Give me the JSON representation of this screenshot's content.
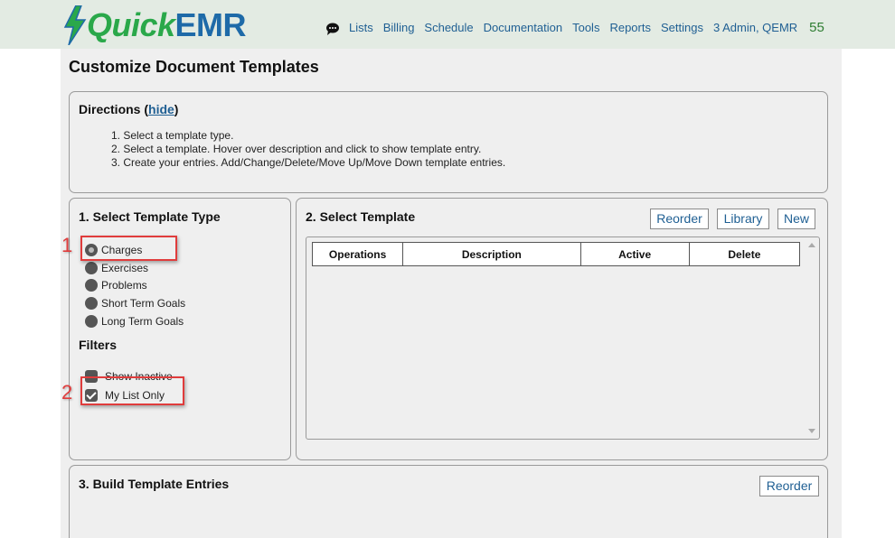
{
  "header": {
    "logo_quick": "Quick",
    "logo_emr": "EMR",
    "nav": [
      "Lists",
      "Billing",
      "Schedule",
      "Documentation",
      "Tools",
      "Reports",
      "Settings",
      "3 Admin, QEMR"
    ],
    "count": "55"
  },
  "page": {
    "title": "Customize Document Templates"
  },
  "directions": {
    "title": "Directions (",
    "hide_label": "hide",
    "title_end": ")",
    "steps": [
      "1. Select a template type.",
      "2. Select a template. Hover over description and click to show template entry.",
      "3. Create your entries. Add/Change/Delete/Move Up/Move Down template entries."
    ]
  },
  "template_type": {
    "title": "1. Select Template Type",
    "options": [
      "Charges",
      "Exercises",
      "Problems",
      "Short Term Goals",
      "Long Term Goals"
    ],
    "selected": "Charges",
    "filters_title": "Filters",
    "filters": [
      {
        "label": "Show Inactive",
        "checked": false
      },
      {
        "label": "My List Only",
        "checked": true
      }
    ]
  },
  "select_template": {
    "title": "2. Select Template",
    "buttons": {
      "reorder": "Reorder",
      "library": "Library",
      "new": "New"
    },
    "columns": [
      "Operations",
      "Description",
      "Active",
      "Delete"
    ]
  },
  "build_entries": {
    "title": "3. Build Template Entries",
    "reorder": "Reorder"
  },
  "annotations": [
    "1",
    "2"
  ],
  "colors": {
    "annotation": "#e03c3c",
    "link": "#1f5f93",
    "brand_green": "#2aa84a",
    "brand_blue": "#1e6aa8"
  }
}
